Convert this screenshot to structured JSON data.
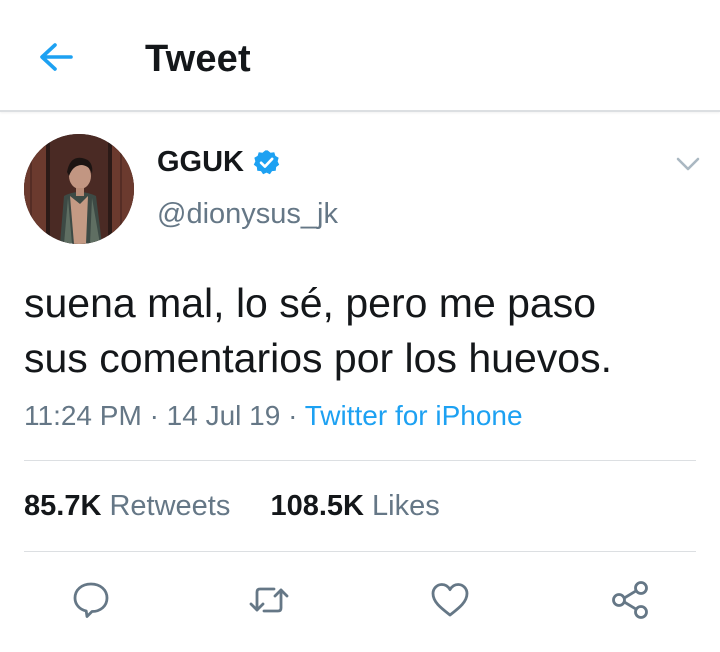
{
  "header": {
    "title": "Tweet",
    "back_icon": "arrow-left-icon",
    "accent": "#1da1f2"
  },
  "author": {
    "display_name": "GGUK",
    "handle": "@dionysus_jk",
    "verified": true,
    "verified_color": "#1da1f2"
  },
  "tweet": {
    "text_line1": "suena mal, lo sé, pero me paso",
    "text_line2": "sus comentarios por los huevos.",
    "time": "11:24 PM",
    "separator": "·",
    "date": "14 Jul 19",
    "source": "Twitter for iPhone"
  },
  "stats": {
    "retweets_count": "85.7K",
    "retweets_label": "Retweets",
    "likes_count": "108.5K",
    "likes_label": "Likes"
  },
  "actions": {
    "icons": [
      "reply-icon",
      "retweet-icon",
      "like-icon",
      "share-icon"
    ]
  },
  "colors": {
    "text_primary": "#14171a",
    "text_secondary": "#657786",
    "divider": "#dcdfe2",
    "link": "#1da1f2"
  }
}
